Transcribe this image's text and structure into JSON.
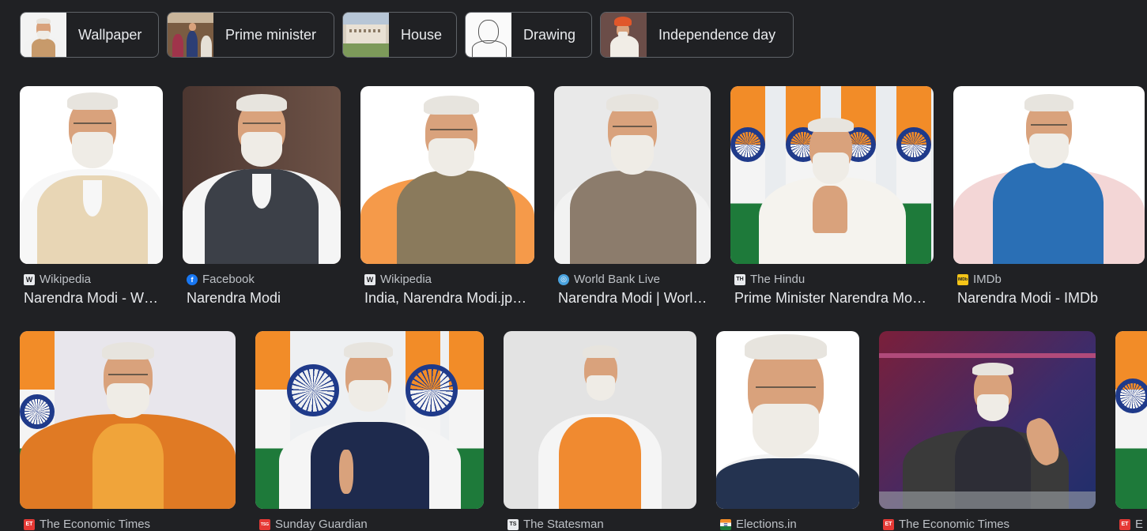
{
  "chips": [
    {
      "label": "Wallpaper"
    },
    {
      "label": "Prime minister"
    },
    {
      "label": "House"
    },
    {
      "label": "Drawing"
    },
    {
      "label": "Independence day"
    }
  ],
  "results_row1": [
    {
      "source": "Wikipedia",
      "favicon": "wikipedia-icon",
      "title": "Narendra Modi - W…"
    },
    {
      "source": "Facebook",
      "favicon": "facebook-icon",
      "title": "Narendra Modi"
    },
    {
      "source": "Wikipedia",
      "favicon": "wikipedia-icon",
      "title": "India, Narendra Modi.jp…"
    },
    {
      "source": "World Bank Live",
      "favicon": "world-bank-icon",
      "title": "Narendra Modi | Worl…"
    },
    {
      "source": "The Hindu",
      "favicon": "the-hindu-icon",
      "title": "Prime Minister Narendra Mo…"
    },
    {
      "source": "IMDb",
      "favicon": "imdb-icon",
      "title": "Narendra Modi - IMDb"
    }
  ],
  "results_row2": [
    {
      "source": "The Economic Times",
      "favicon": "economic-times-icon"
    },
    {
      "source": "Sunday Guardian",
      "favicon": "sunday-guardian-icon"
    },
    {
      "source": "The Statesman",
      "favicon": "statesman-icon"
    },
    {
      "source": "Elections.in",
      "favicon": "elections-in-icon"
    },
    {
      "source": "The Economic Times",
      "favicon": "economic-times-icon"
    },
    {
      "source": "E",
      "favicon": "economic-times-icon"
    }
  ],
  "favicon_glyphs": {
    "wikipedia": "W",
    "facebook": "f",
    "world_bank": "◎",
    "the_hindu": "TH",
    "imdb": "IMDb",
    "economic_times": "ET",
    "sunday_guardian": "TSG",
    "statesman": "TS",
    "elections_in": "≡"
  },
  "colors": {
    "background": "#202124",
    "chip_border": "#5f6368",
    "text_primary": "#e8eaed",
    "text_secondary": "#bdc1c6"
  }
}
